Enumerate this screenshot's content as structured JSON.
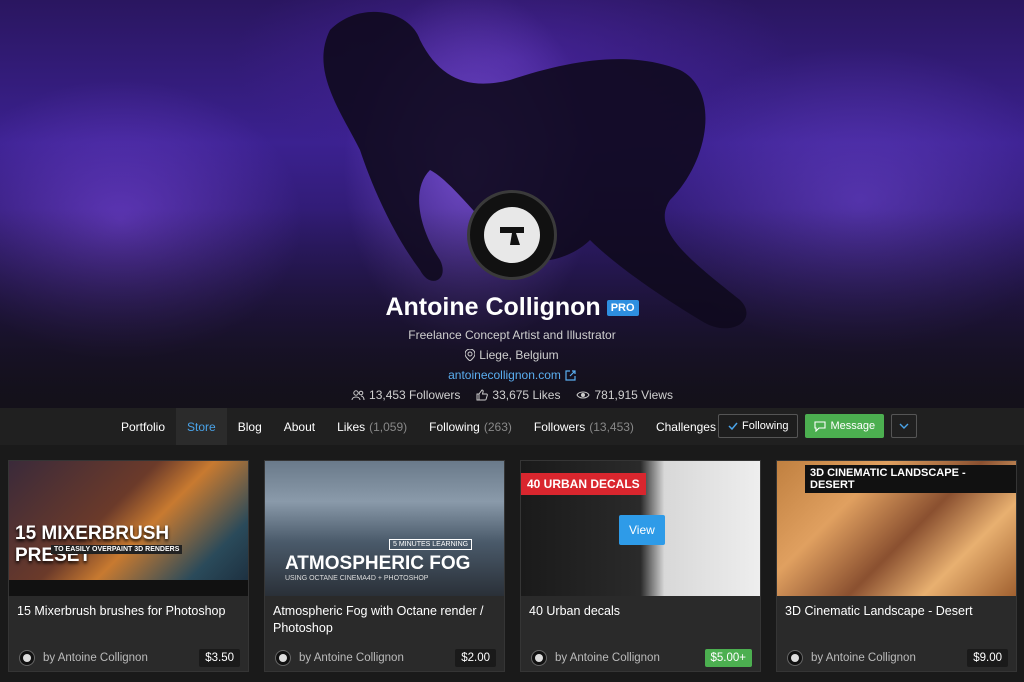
{
  "profile": {
    "name": "Antoine Collignon",
    "badge": "PRO",
    "tagline": "Freelance Concept Artist and Illustrator",
    "location": "Liege, Belgium",
    "website": "antoinecollignon.com",
    "followers": "13,453 Followers",
    "likes": "33,675 Likes",
    "views": "781,915 Views"
  },
  "nav": {
    "items": [
      {
        "label": "Portfolio",
        "count": ""
      },
      {
        "label": "Store",
        "count": ""
      },
      {
        "label": "Blog",
        "count": ""
      },
      {
        "label": "About",
        "count": ""
      },
      {
        "label": "Likes",
        "count": "(1,059)"
      },
      {
        "label": "Following",
        "count": "(263)"
      },
      {
        "label": "Followers",
        "count": "(13,453)"
      },
      {
        "label": "Challenges",
        "count": ""
      }
    ],
    "active": "Store",
    "following_label": "Following",
    "message_label": "Message"
  },
  "cards": [
    {
      "thumb_title": "15 MIXERBRUSH PRESET",
      "thumb_sub": "TO EASILY OVERPAINT 3D RENDERS",
      "title": "15 Mixerbrush brushes for Photoshop",
      "author": "by Antoine Collignon",
      "price": "$3.50"
    },
    {
      "thumb_tag": "5 MINUTES LEARNING",
      "thumb_title": "ATMOSPHERIC FOG",
      "thumb_sub": "USING OCTANE CINEMA4D + PHOTOSHOP",
      "title": "Atmospheric Fog with Octane render / Photoshop",
      "author": "by Antoine Collignon",
      "price": "$2.00"
    },
    {
      "thumb_title": "40 URBAN DECALS",
      "view_label": "View",
      "title": "40 Urban decals",
      "author": "by Antoine Collignon",
      "price": "$5.00+"
    },
    {
      "thumb_title": "3D CINEMATIC LANDSCAPE - DESERT",
      "title": "3D Cinematic Landscape - Desert",
      "author": "by Antoine Collignon",
      "price": "$9.00"
    }
  ]
}
